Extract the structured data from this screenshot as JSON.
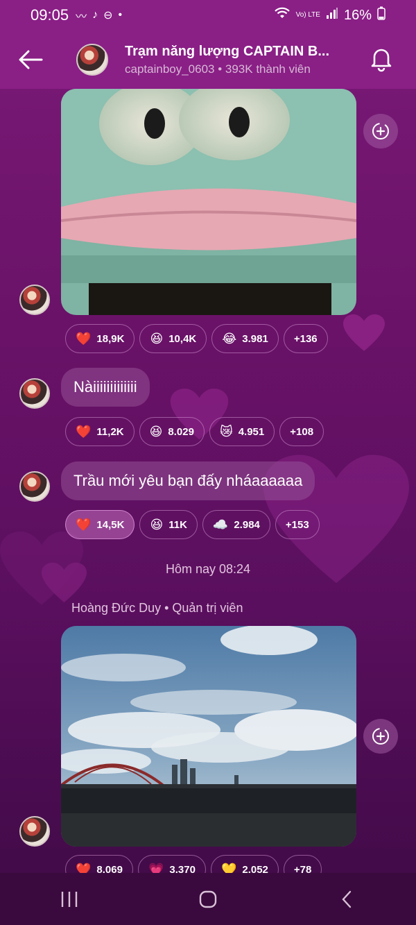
{
  "status_bar": {
    "time": "09:05",
    "battery": "16%",
    "network": "Vo) LTE"
  },
  "header": {
    "title": "Trạm năng lượng CAPTAIN B...",
    "subtitle": "captainboy_0603 • 393K thành viên"
  },
  "messages": [
    {
      "type": "image",
      "image": "green-frog-face-photo",
      "reactions": [
        {
          "emoji": "❤️",
          "count": "18,9K"
        },
        {
          "emoji": "😆",
          "count": "10,4K"
        },
        {
          "emoji": "😂",
          "count": "3.981"
        },
        {
          "emoji": "",
          "count": "+136"
        }
      ]
    },
    {
      "type": "text",
      "text": "Nàiiiiiiiiiiiii",
      "reactions": [
        {
          "emoji": "❤️",
          "count": "11,2K"
        },
        {
          "emoji": "😆",
          "count": "8.029"
        },
        {
          "emoji": "😿",
          "count": "4.951"
        },
        {
          "emoji": "",
          "count": "+108"
        }
      ]
    },
    {
      "type": "text",
      "text": "Trầu mới yêu bạn đấy nháaaaaaa",
      "reactions": [
        {
          "emoji": "❤️",
          "count": "14,5K",
          "active": true
        },
        {
          "emoji": "😆",
          "count": "11K"
        },
        {
          "emoji": "☁️",
          "count": "2.984"
        },
        {
          "emoji": "",
          "count": "+153"
        }
      ]
    }
  ],
  "divider": {
    "timestamp": "Hôm nay 08:24"
  },
  "sender_line": "Hoàng Đức Duy • Quản trị viên",
  "last_message": {
    "type": "image",
    "image": "sky-bridge-city-photo",
    "reactions": [
      {
        "emoji": "❤️",
        "count": "8.069"
      },
      {
        "emoji": "💗",
        "count": "3.370"
      },
      {
        "emoji": "💛",
        "count": "2.052"
      },
      {
        "emoji": "",
        "count": "+78"
      }
    ]
  },
  "colors": {
    "header_bg": "#8a1f86",
    "bg_top": "#7a1a78",
    "bg_bottom": "#3e0a45",
    "nav_bg": "#3a0a3e"
  }
}
